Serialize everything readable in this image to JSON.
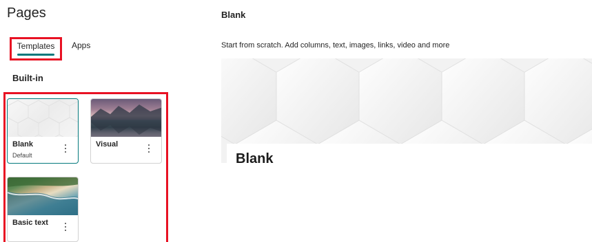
{
  "left_panel": {
    "title": "Pages",
    "tabs": [
      {
        "label": "Templates",
        "selected": true
      },
      {
        "label": "Apps",
        "selected": false
      }
    ],
    "section_label": "Built-in",
    "templates": [
      {
        "name": "Blank",
        "subtitle": "Default",
        "selected": true
      },
      {
        "name": "Visual",
        "subtitle": "",
        "selected": false
      },
      {
        "name": "Basic text",
        "subtitle": "",
        "selected": false
      }
    ]
  },
  "preview": {
    "title": "Blank",
    "description": "Start from scratch. Add columns, text, images, links, video and more",
    "heading": "Blank"
  },
  "colors": {
    "accent": "#03787c",
    "highlight_box": "#e81123"
  }
}
